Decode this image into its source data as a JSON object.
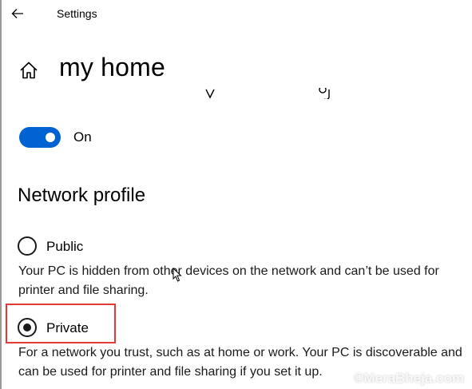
{
  "window": {
    "title": "Settings"
  },
  "page": {
    "title": "my home"
  },
  "toggle": {
    "state_label": "On",
    "on": true,
    "accent": "#0063d1"
  },
  "network_profile": {
    "heading": "Network profile",
    "options": [
      {
        "label": "Public",
        "checked": false,
        "description": "Your PC is hidden from other devices on the network and can’t be used for printer and file sharing."
      },
      {
        "label": "Private",
        "checked": true,
        "description": "For a network you trust, such as at home or work. Your PC is discoverable and can be used for printer and file sharing if you set it up."
      }
    ]
  },
  "annotation": {
    "highlight_color": "#e53935"
  },
  "watermark": {
    "text": "©MeraBheja.com"
  }
}
